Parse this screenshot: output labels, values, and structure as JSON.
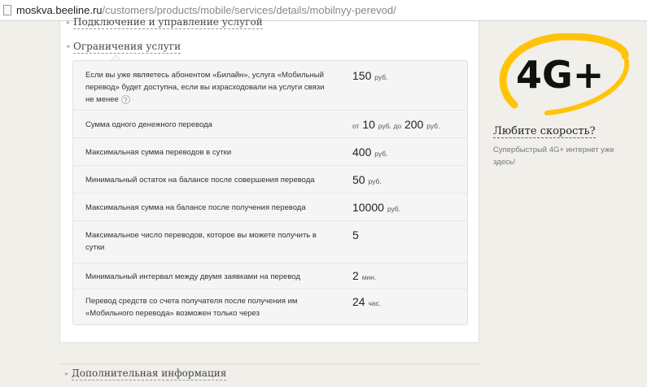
{
  "browser": {
    "url_host": "moskva.beeline.ru",
    "url_path": "/customers/products/mobile/services/details/mobilnyy-perevod/"
  },
  "sections": {
    "connect_title": "Подключение и управление услугой",
    "limits_title": "Ограничения услуги",
    "more_title": "Дополнительная информация"
  },
  "limits": [
    {
      "label": "Если вы уже являетесь абонентом «Билайн», услуга «Мобильный перевод» будет доступна, если вы израсходовали на услуги связи не менее",
      "help_icon": "?",
      "value": "150",
      "unit": "руб."
    },
    {
      "label": "Сумма одного денежного перевода",
      "value_pre": "от",
      "value": "10",
      "unit": "руб. до",
      "value2": "200",
      "unit2": "руб."
    },
    {
      "label": "Максимальная сумма переводов в сутки",
      "value": "400",
      "unit": "руб."
    },
    {
      "label": "Минимальный остаток на балансе после совершения перевода",
      "value": "50",
      "unit": "руб."
    },
    {
      "label": "Максимальная сумма на балансе после получения перевода",
      "value": "10000",
      "unit": "руб."
    },
    {
      "label": "Максимальное число переводов, которое вы можете получить в сутки",
      "value": "5",
      "unit": ""
    },
    {
      "label": "Минимальный интервал между двумя заявками на перевод",
      "value": "2",
      "unit": "мин."
    },
    {
      "label": "Перевод средств со счета получателя после получения им «Мобильного перевода» возможен только через",
      "value": "24",
      "unit": "час."
    }
  ],
  "promo": {
    "logo_text": "4G+",
    "link": "Любите скорость?",
    "text": "Супербыстрый 4G+ интернет уже здесь!",
    "accent_color": "#ffc40a"
  }
}
